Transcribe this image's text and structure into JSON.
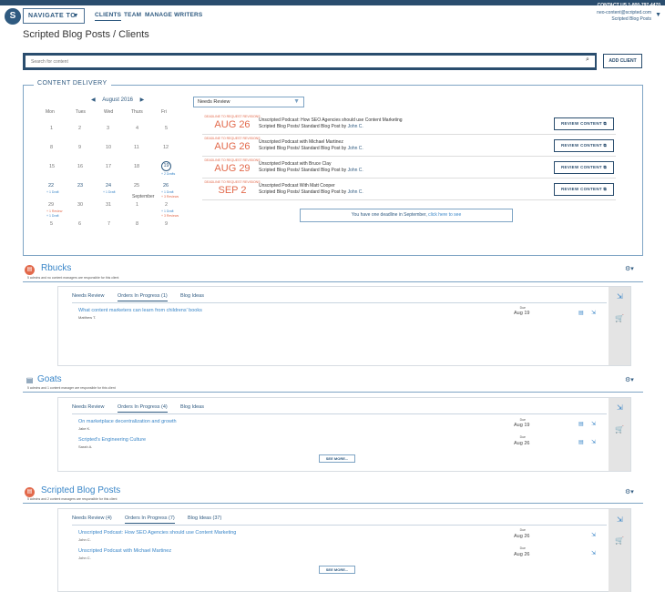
{
  "topbar": {
    "logo_glyph": "S",
    "nav_to": "NAVIGATE TO",
    "menu": [
      "CLIENTS",
      "TEAM",
      "MANAGE WRITERS"
    ],
    "contact": "CONTACT US 1-800-797-4470",
    "email": "neo-content@scripted.com",
    "account": "Scripted Blog Posts"
  },
  "page": {
    "title": "Scripted Blog Posts / Clients"
  },
  "search": {
    "placeholder": "Search for content",
    "add_client": "ADD CLIENT"
  },
  "content_delivery": {
    "label": "CONTENT DELIVERY",
    "month": "August 2016",
    "weekdays": [
      "Mon",
      "Tues",
      "Wed",
      "Thurs",
      "Fri"
    ],
    "weeks": [
      [
        "1",
        "2",
        "3",
        "4",
        "5"
      ],
      [
        "8",
        "9",
        "10",
        "11",
        "12"
      ],
      [
        "15",
        "16",
        "17",
        "18",
        "19"
      ],
      [
        "22",
        "23",
        "24",
        "25",
        "26"
      ],
      [
        "29",
        "30",
        "31",
        "1",
        "2"
      ],
      [
        "5",
        "6",
        "7",
        "8",
        "9"
      ]
    ],
    "cal_notes": {
      "w3_fri": "+ 2 Drafts",
      "w4_mon": "+ 1 Draft",
      "w4_wed": "+ 1 Draft",
      "w4_fri_a": "+ 1 Draft",
      "w4_fri_b": "+ 3 Reviews",
      "w5_mon_a": "+ 1 Review",
      "w5_mon_b": "+ 1 Draft",
      "w5_fri_a": "+ 1 Draft",
      "w5_fri_b": "+ 3 Reviews",
      "september": "September"
    },
    "filter": "Needs Review",
    "deadline_label": "DEADLINE TO REQUEST REVISIONS",
    "deadlines": [
      {
        "date": "AUG 26",
        "title": "Unscripted Podcast: How SEO Agencies should use Content Marketing",
        "kind": "Scripted Blog Posts/ Standard Blog Post by ",
        "author": "John C."
      },
      {
        "date": "AUG 26",
        "title": "Unscripted Podcast with Michael Martinez",
        "kind": "Scripted Blog Posts/ Standard Blog Post by ",
        "author": "John C."
      },
      {
        "date": "AUG 29",
        "title": "Unscripted Podcast with Bruce Clay",
        "kind": "Scripted Blog Posts/ Standard Blog Post by ",
        "author": "John C."
      },
      {
        "date": "SEP 2",
        "title": "Unscripted Podcast With Matt Cooper",
        "kind": "Scripted Blog Posts/ Standard Blog Post by ",
        "author": "John C."
      }
    ],
    "review_label": "REVIEW CONTENT",
    "one_deadline": "You have one deadline in September, ",
    "click_here": "click here to see"
  },
  "clients": [
    {
      "name": "Rbucks",
      "sub": "5 admins and no content managers are responsible for this client",
      "tabs": [
        "Needs Review",
        "Orders In Progress (1)",
        "Blog Ideas"
      ],
      "orders": [
        {
          "title": "What content marketers can learn from childrens' books",
          "who": "Matthew T.",
          "due_label": "Due",
          "due": "Aug 19"
        }
      ]
    },
    {
      "name": "Goats",
      "sub": "5 admins and 1 content manager are responsible for this client",
      "tabs": [
        "Needs Review",
        "Orders In Progress (4)",
        "Blog Ideas"
      ],
      "orders": [
        {
          "title": "On marketplace decentralization and growth",
          "who": "Jake K.",
          "due_label": "Due",
          "due": "Aug 19"
        },
        {
          "title": "Scripted's Engineering Culture",
          "who": "Sarah A.",
          "due_label": "Due",
          "due": "Aug 26"
        }
      ],
      "see_more": "SEE MORE..."
    },
    {
      "name": "Scripted Blog Posts",
      "sub": "5 admins and 2 content managers are responsible for this client",
      "tabs": [
        "Needs Review (4)",
        "Orders In Progress (7)",
        "Blog Ideas (37)"
      ],
      "orders": [
        {
          "title": "Unscripted Podcast: How SEO Agencies should use Content Marketing",
          "who": "John C.",
          "due_label": "Due",
          "due": "Aug 26"
        },
        {
          "title": "Unscripted Podcast with Michael Martinez",
          "who": "John C.",
          "due_label": "Due",
          "due": "Aug 26"
        }
      ],
      "see_more": "SEE MORE..."
    }
  ],
  "icons": {
    "search": "magnifier-icon",
    "gear": "gear-icon",
    "chat": "chat-icon",
    "export": "export-icon",
    "cart": "cart-icon",
    "chevron": "chevron-down-icon"
  },
  "colors": {
    "navy": "#2a4d6e",
    "accent": "#3a86c8",
    "deadline": "#e2694b",
    "cart": "#3aa655"
  }
}
